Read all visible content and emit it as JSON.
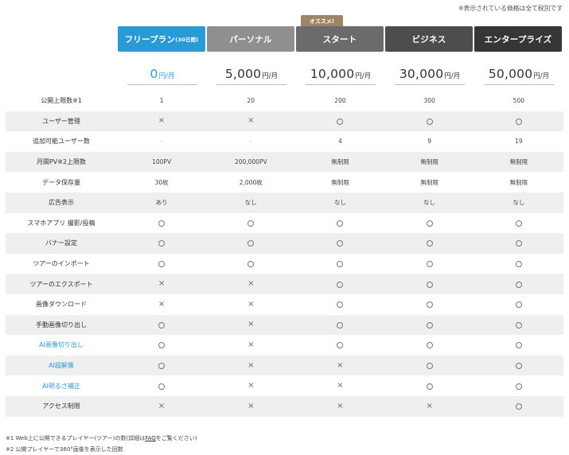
{
  "tax_note": "※表示されている価格は全て税別です",
  "recommend_badge": "オススメ!",
  "plans": [
    {
      "name": "フリープラン",
      "sub": "(30日間)",
      "price": "0",
      "unit": "円/月",
      "color": "#2a9ad6"
    },
    {
      "name": "パーソナル",
      "sub": "",
      "price": "5,000",
      "unit": "円/月",
      "color": "#8f8f8f"
    },
    {
      "name": "スタート",
      "sub": "",
      "price": "10,000",
      "unit": "円/月",
      "color": "#6b6b6b"
    },
    {
      "name": "ビジネス",
      "sub": "",
      "price": "30,000",
      "unit": "円/月",
      "color": "#4d4d4d"
    },
    {
      "name": "エンタープライズ",
      "sub": "",
      "price": "50,000",
      "unit": "円/月",
      "color": "#363636"
    }
  ],
  "rows": [
    {
      "label": "公開上限数※1",
      "values": [
        "1",
        "20",
        "200",
        "300",
        "500"
      ]
    },
    {
      "label": "ユーザー管理",
      "values": [
        "×",
        "×",
        "○",
        "○",
        "○"
      ]
    },
    {
      "label": "追加可能ユーザー数",
      "values": [
        "-",
        "-",
        "4",
        "9",
        "19"
      ]
    },
    {
      "label": "月間PV※2上限数",
      "values": [
        "100PV",
        "200,000PV",
        "無制限",
        "無制限",
        "無制限"
      ]
    },
    {
      "label": "データ保存量",
      "values": [
        "30枚",
        "2,000枚",
        "無制限",
        "無制限",
        "無制限"
      ]
    },
    {
      "label": "広告表示",
      "values": [
        "あり",
        "なし",
        "なし",
        "なし",
        "なし"
      ]
    },
    {
      "label": "スマホアプリ 撮影/投稿",
      "values": [
        "○",
        "○",
        "○",
        "○",
        "○"
      ]
    },
    {
      "label": "バナー設定",
      "values": [
        "○",
        "○",
        "○",
        "○",
        "○"
      ]
    },
    {
      "label": "ツアーのインポート",
      "values": [
        "○",
        "○",
        "○",
        "○",
        "○"
      ]
    },
    {
      "label": "ツアーのエクスポート",
      "values": [
        "×",
        "×",
        "○",
        "○",
        "○"
      ]
    },
    {
      "label": "画像ダウンロード",
      "values": [
        "×",
        "×",
        "○",
        "○",
        "○"
      ]
    },
    {
      "label": "手動画像切り出し",
      "values": [
        "○",
        "×",
        "○",
        "○",
        "○"
      ]
    },
    {
      "label": "AI画像切り出し",
      "values": [
        "○",
        "×",
        "○",
        "○",
        "○"
      ],
      "link": true
    },
    {
      "label": "AI超解像",
      "values": [
        "○",
        "×",
        "×",
        "○",
        "○"
      ],
      "link": true
    },
    {
      "label": "AI明るさ補正",
      "values": [
        "○",
        "×",
        "×",
        "○",
        "○"
      ],
      "link": true
    },
    {
      "label": "アクセス制限",
      "values": [
        "×",
        "×",
        "×",
        "×",
        "○"
      ]
    }
  ],
  "footnotes": {
    "note1_prefix": "※1 Web上に公開できるプレイヤー(ツアー)の数(詳細は",
    "note1_link": "FAQ",
    "note1_suffix": "をご覧ください)",
    "note2": "※2 公開プレイヤーで360°画像を表示した回数"
  }
}
